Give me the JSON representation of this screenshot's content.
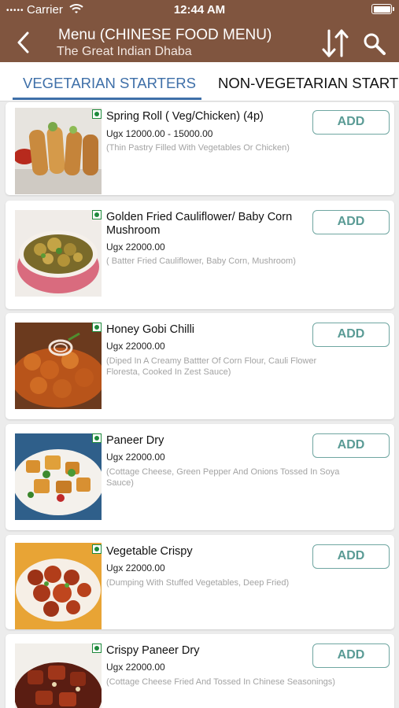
{
  "status_bar": {
    "carrier": "Carrier",
    "time": "12:44 AM",
    "signal": "•••••"
  },
  "header": {
    "title": "Menu (CHINESE FOOD MENU)",
    "subtitle": "The Great Indian Dhaba",
    "back_icon": "chevron-left-icon",
    "sort_icon": "sort-arrows-icon",
    "search_icon": "search-icon"
  },
  "tabs": [
    {
      "label": "VEGETARIAN STARTERS",
      "selected": true
    },
    {
      "label": "NON-VEGETARIAN STARTERS",
      "selected": false
    }
  ],
  "colors": {
    "header": "#80553f",
    "accent": "#3e6fa8",
    "add_button": "#5a9b95",
    "veg_mark": "#1e8a3c"
  },
  "items": [
    {
      "name": "Spring Roll ( Veg/Chicken) (4p)",
      "price": "Ugx 12000.00 - 15000.00",
      "description": "(Thin Pastry Filled With Vegetables Or Chicken)",
      "add_label": "ADD"
    },
    {
      "name": "Golden Fried Cauliflower/ Baby Corn Mushroom",
      "price": "Ugx 22000.00",
      "description": "( Batter Fried Cauliflower, Baby Corn, Mushroom)",
      "add_label": "ADD"
    },
    {
      "name": "Honey Gobi Chilli",
      "price": "Ugx 22000.00",
      "description": "(Diped In A Creamy Battter Of Corn Flour, Cauli Flower Floresta, Cooked In Zest Sauce)",
      "add_label": "ADD"
    },
    {
      "name": "Paneer Dry",
      "price": "Ugx 22000.00",
      "description": "(Cottage Cheese, Green Pepper And Onions Tossed In Soya Sauce)",
      "add_label": "ADD"
    },
    {
      "name": "Vegetable Crispy",
      "price": "Ugx 22000.00",
      "description": "(Dumping With Stuffed Vegetables, Deep Fried)",
      "add_label": "ADD"
    },
    {
      "name": "Crispy Paneer Dry",
      "price": "Ugx 22000.00",
      "description": "(Cottage Cheese Fried And Tossed In Chinese Seasonings)",
      "add_label": "ADD"
    }
  ]
}
